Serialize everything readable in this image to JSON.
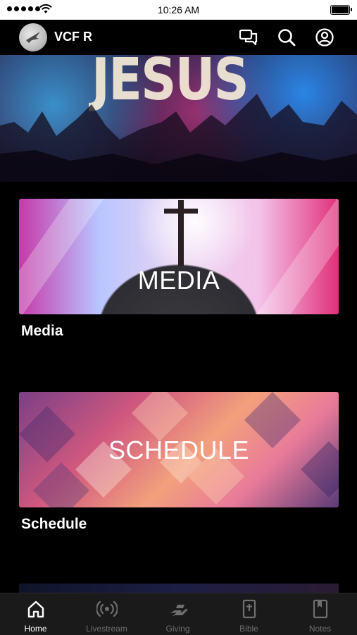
{
  "status_bar": {
    "time": "10:26 AM"
  },
  "header": {
    "title": "VCF R"
  },
  "hero": {
    "text": "JESUS"
  },
  "cards": [
    {
      "image_text": "MEDIA",
      "label": "Media"
    },
    {
      "image_text": "SCHEDULE",
      "label": "Schedule"
    }
  ],
  "tabs": [
    {
      "label": "Home",
      "icon": "home-icon",
      "active": true
    },
    {
      "label": "Livestream",
      "icon": "broadcast-icon",
      "active": false
    },
    {
      "label": "Giving",
      "icon": "giving-hand-icon",
      "active": false
    },
    {
      "label": "Bible",
      "icon": "bible-icon",
      "active": false
    },
    {
      "label": "Notes",
      "icon": "notes-icon",
      "active": false
    }
  ],
  "colors": {
    "active_tab": "#ffffff",
    "inactive_tab": "#6f6f6f",
    "background": "#000000"
  }
}
